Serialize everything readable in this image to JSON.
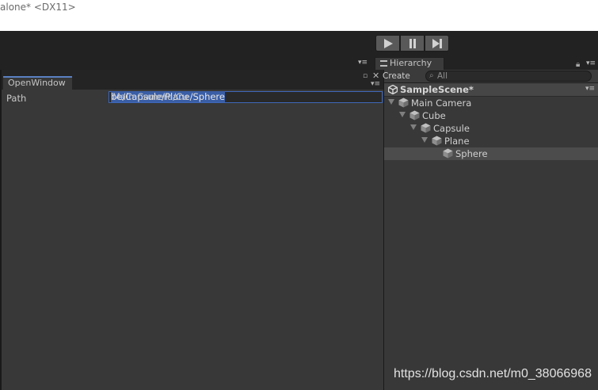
{
  "window": {
    "title": "alone* <DX11>"
  },
  "playbar": {
    "play": "play-icon",
    "pause": "pause-icon",
    "step": "step-icon"
  },
  "open_window": {
    "tab_label": "OpenWindow",
    "path_label": "Path",
    "path_value_unselected": "Main Camera/Cu",
    "path_value_selected": "be/Capsule/Plane/Sphere"
  },
  "hierarchy": {
    "tab_label": "Hierarchy",
    "create_label": "Create",
    "search_placeholder": "All",
    "scene_name": "SampleScene*",
    "items": [
      {
        "label": "Main Camera",
        "depth": 0,
        "expanded": true,
        "selected": false
      },
      {
        "label": "Cube",
        "depth": 1,
        "expanded": true,
        "selected": false
      },
      {
        "label": "Capsule",
        "depth": 2,
        "expanded": true,
        "selected": false
      },
      {
        "label": "Plane",
        "depth": 3,
        "expanded": true,
        "selected": false
      },
      {
        "label": "Sphere",
        "depth": 4,
        "expanded": false,
        "selected": true
      }
    ]
  },
  "watermark": "https://blog.csdn.net/m0_38066968",
  "colors": {
    "selection": "#3a5ea6",
    "tab_accent": "#5a7fc2",
    "panel": "#383838"
  }
}
